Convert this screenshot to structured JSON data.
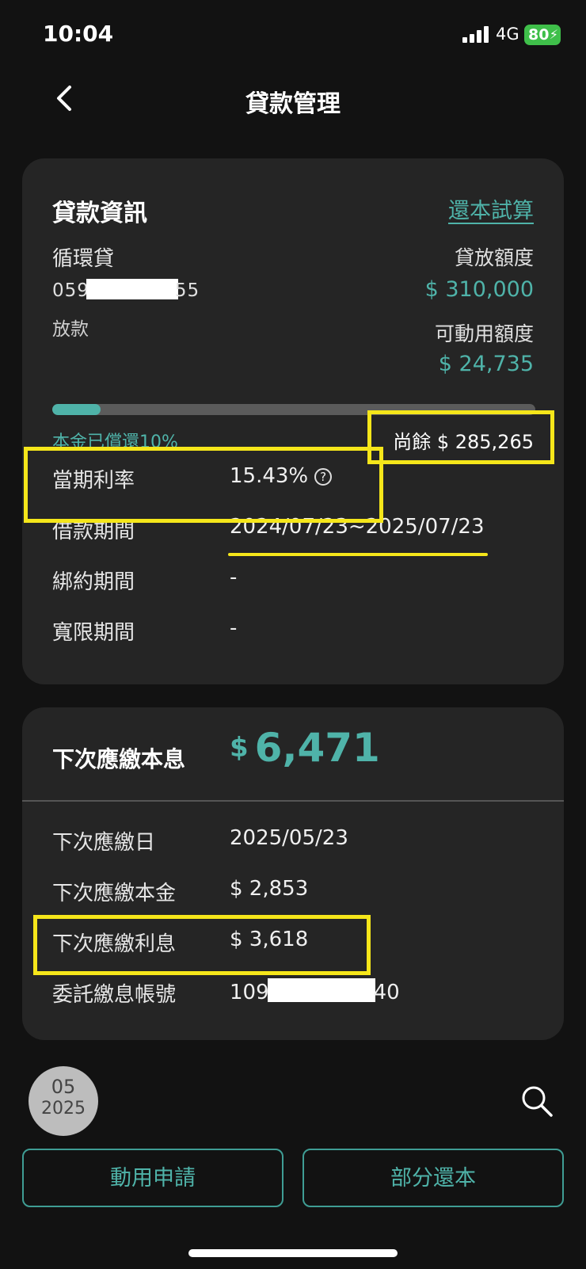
{
  "status_bar": {
    "time": "10:04",
    "network": "4G",
    "battery": "80"
  },
  "header": {
    "title": "貸款管理"
  },
  "loan_info": {
    "title": "貸款資訊",
    "calc_link": "還本試算",
    "loan_type": "循環貸",
    "account_prefix": "059",
    "account_suffix": "55",
    "status": "放款",
    "limit_label": "貸放額度",
    "limit_value": "$ 310,000",
    "available_label": "可動用額度",
    "available_value": "$ 24,735",
    "repaid_fraction": 0.1,
    "repaid_text": "本金已償還10%",
    "remaining_text": "尚餘 $ 285,265",
    "rows": [
      {
        "label": "當期利率",
        "value": "15.43%"
      },
      {
        "label": "借款期間",
        "value": "2024/07/23~2025/07/23"
      },
      {
        "label": "綁約期間",
        "value": "-"
      },
      {
        "label": "寬限期間",
        "value": "-"
      }
    ]
  },
  "next_payment": {
    "title": "下次應繳本息",
    "currency": "$",
    "amount": "6,471",
    "rows": [
      {
        "label": "下次應繳日",
        "value": "2025/05/23"
      },
      {
        "label": "下次應繳本金",
        "value": "$ 2,853"
      },
      {
        "label": "下次應繳利息",
        "value": "$ 3,618"
      }
    ],
    "debit_label": "委託繳息帳號",
    "debit_prefix": "109",
    "debit_suffix": "40"
  },
  "date_badge": {
    "month": "05",
    "year": "2025"
  },
  "buttons": {
    "drawdown": "動用申請",
    "partial_repay": "部分還本"
  },
  "colors": {
    "accent": "#4fb3a9",
    "highlight": "#f5e61a",
    "background": "#121212",
    "card": "#252525"
  }
}
